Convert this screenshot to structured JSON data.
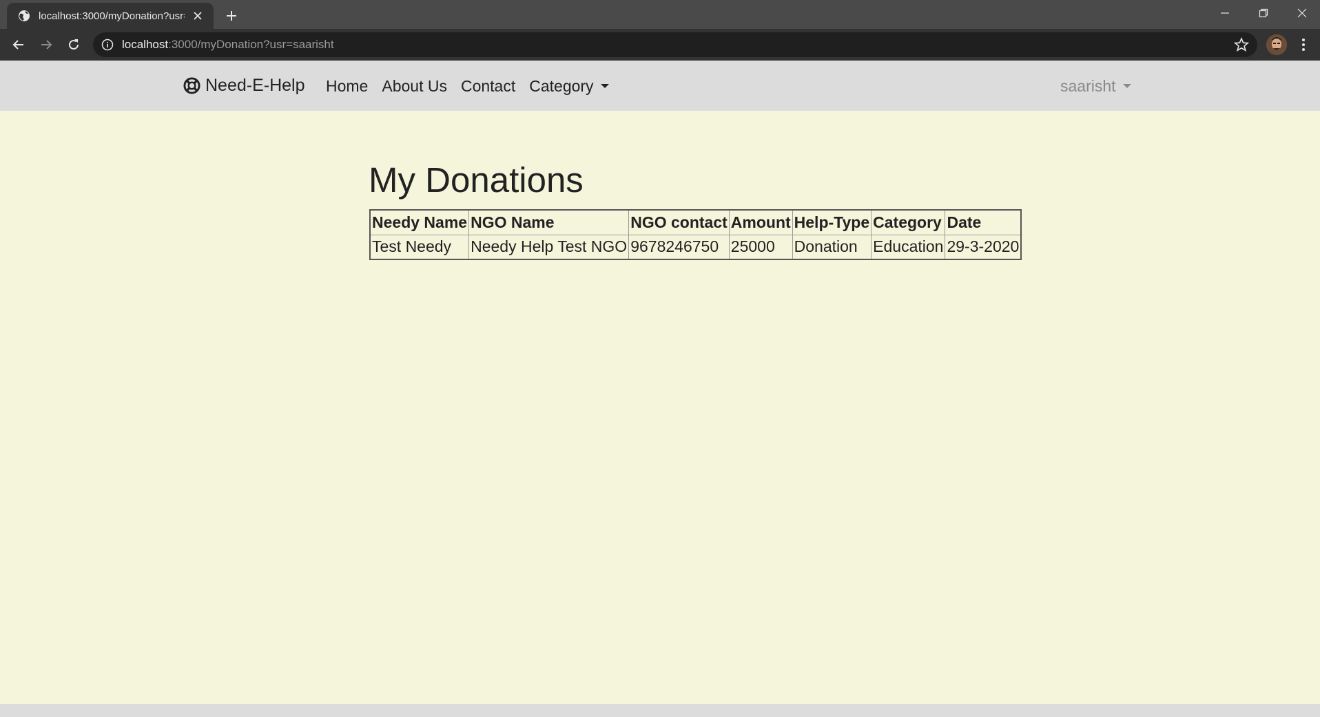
{
  "browser": {
    "tab_title": "localhost:3000/myDonation?usr=saarisht",
    "url_host": "localhost",
    "url_rest": ":3000/myDonation?usr=saarisht"
  },
  "navbar": {
    "brand": "Need-E-Help",
    "links": [
      "Home",
      "About Us",
      "Contact",
      "Category"
    ],
    "user": "saarisht"
  },
  "page": {
    "title": "My Donations"
  },
  "table": {
    "headers": [
      "Needy Name",
      "NGO Name",
      "NGO contact",
      "Amount",
      "Help-Type",
      "Category",
      "Date"
    ],
    "rows": [
      [
        "Test Needy",
        "Needy Help Test NGO",
        "9678246750",
        "25000",
        "Donation",
        "Education",
        "29-3-2020"
      ]
    ]
  },
  "colors": {
    "page_background": "#f5f5dc",
    "navbar_background": "#dcdcdc",
    "browser_chrome": "#333333"
  }
}
